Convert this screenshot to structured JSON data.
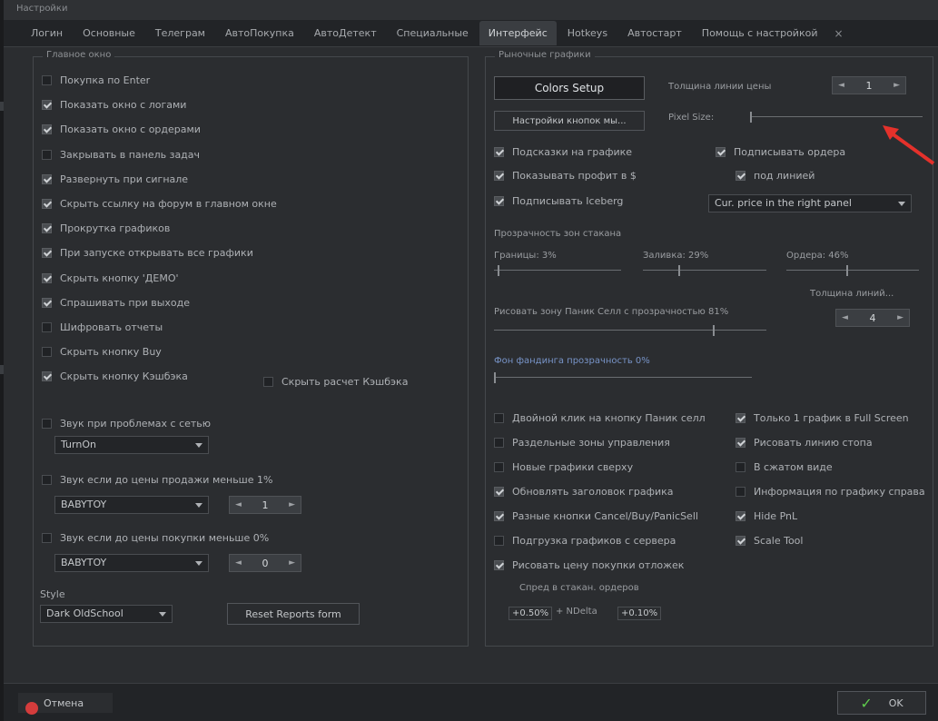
{
  "window": {
    "title": "Настройки"
  },
  "tabs": [
    {
      "label": "Логин"
    },
    {
      "label": "Основные"
    },
    {
      "label": "Телеграм"
    },
    {
      "label": "АвтоПокупка"
    },
    {
      "label": "АвтоДетект"
    },
    {
      "label": "Специальные"
    },
    {
      "label": "Интерфейс"
    },
    {
      "label": "Hotkeys"
    },
    {
      "label": "Автостарт"
    },
    {
      "label": "Помощь с настройкой"
    }
  ],
  "tab_close": "×",
  "main_window": {
    "title": "Главное окно",
    "checkboxes": [
      {
        "label": "Покупка по Enter",
        "checked": false
      },
      {
        "label": "Показать окно с логами",
        "checked": true
      },
      {
        "label": "Показать окно с ордерами",
        "checked": true
      },
      {
        "label": "Закрывать в панель задач",
        "checked": false
      },
      {
        "label": "Развернуть при сигнале",
        "checked": true
      },
      {
        "label": "Скрыть ссылку на форум в главном окне",
        "checked": true
      },
      {
        "label": "Прокрутка графиков",
        "checked": true
      },
      {
        "label": "При запуске открывать все графики",
        "checked": true
      },
      {
        "label": "Скрыть кнопку 'ДЕМО'",
        "checked": true
      },
      {
        "label": "Спрашивать при выходе",
        "checked": true
      },
      {
        "label": "Шифровать отчеты",
        "checked": false
      },
      {
        "label": "Скрыть кнопку Buy",
        "checked": false
      },
      {
        "label": "Скрыть кнопку Кэшбэка",
        "checked": true
      }
    ],
    "hide_cashback_calc": {
      "label": "Скрыть расчет Кэшбэка",
      "checked": false
    },
    "sound_network": {
      "label": "Звук при проблемах с сетью",
      "checked": false
    },
    "sound_network_select": "TurnOn",
    "sound_sell": {
      "label": "Звук если до цены продажи меньше 1%",
      "checked": false
    },
    "sound_sell_select": "BABYTOY",
    "sound_sell_spin": "1",
    "sound_buy": {
      "label": "Звук если до цены покупки меньше 0%",
      "checked": false
    },
    "sound_buy_select": "BABYTOY",
    "sound_buy_spin": "0",
    "style_label": "Style",
    "style_select": "Dark OldSchool",
    "reset_reports_button": "Reset Reports form"
  },
  "charts": {
    "title": "Рыночные графики",
    "colors_setup_button": "Colors Setup",
    "price_line_thickness_label": "Толщина линии цены",
    "price_line_thickness_value": "1",
    "buttons_settings_button": "Настройки кнопок мы...",
    "pixel_size_label": "Pixel Size:",
    "pixel_size_fraction": 0.0,
    "chart_hints": {
      "label": "Подсказки на графике",
      "checked": true
    },
    "sign_orders": {
      "label": "Подписывать ордера",
      "checked": true
    },
    "show_profit": {
      "label": "Показывать профит в $",
      "checked": true
    },
    "under_line": {
      "label": "под линией",
      "checked": true
    },
    "sign_iceberg": {
      "label": "Подписывать Iceberg",
      "checked": true
    },
    "price_panel_select": "Cur. price in the right panel",
    "glass_transparency_label": "Прозрачность зон стакана",
    "borders_label": "Границы: 3%",
    "borders_fraction": 0.03,
    "fill_label": "Заливка: 29%",
    "fill_fraction": 0.29,
    "orders_label": "Ордера: 46%",
    "orders_fraction": 0.46,
    "line_thickness_label": "Толщина линий...",
    "panic_sell_label": "Рисовать зону Паник Селл с прозрачностью 81%",
    "panic_sell_fraction": 0.81,
    "panic_spin": "4",
    "background_label": "Фон фандинга прозрачность 0%",
    "background_fraction": 0.0,
    "checks_left": [
      {
        "label": "Двойной клик на кнопку Паник селл",
        "checked": false
      },
      {
        "label": "Раздельные зоны управления",
        "checked": false
      },
      {
        "label": "Новые графики сверху",
        "checked": false
      },
      {
        "label": "Обновлять заголовок графика",
        "checked": true
      },
      {
        "label": "Разные кнопки Cancel/Buy/PanicSell",
        "checked": true
      },
      {
        "label": "Подгрузка графиков с сервера",
        "checked": false
      },
      {
        "label": "Рисовать цену покупки отложек",
        "checked": true
      }
    ],
    "checks_right": [
      {
        "label": "Только 1 график в Full Screen",
        "checked": true
      },
      {
        "label": "Рисовать линию стопа",
        "checked": true
      },
      {
        "label": "В сжатом виде",
        "checked": false
      },
      {
        "label": "Информация по графику справа",
        "checked": false
      },
      {
        "label": "Hide PnL",
        "checked": true
      },
      {
        "label": "Scale Tool",
        "checked": true
      }
    ],
    "spread_label": "Спред в стакан. ордеров",
    "spread_left": "+0.50%",
    "spread_ndelta": "+ NDelta",
    "spread_right": "+0.10%"
  },
  "footer": {
    "cancel_label": "Отмена",
    "ok_label": "OK",
    "ok_check": "✓"
  },
  "colors": {
    "accent_red": "#d43c3c",
    "ok_green": "#5ecb4d",
    "link_blue": "#7894c8"
  }
}
